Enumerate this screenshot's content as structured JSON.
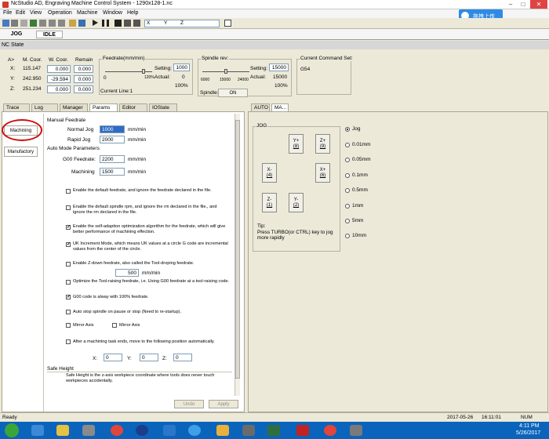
{
  "window": {
    "title": "NcStudio AD, Engraving Machine Control System - 1290x128-1.nc"
  },
  "menu": [
    "File",
    "Edit",
    "View",
    "Operation",
    "Machine",
    "Window",
    "Help"
  ],
  "toolbar": {
    "axis_x": "X",
    "axis_y": "Y",
    "axis_z": "Z"
  },
  "cloud_button": {
    "label": "拖拽上传"
  },
  "mode": {
    "jog": "JOG",
    "idle": "IDLE"
  },
  "nc_state": {
    "header": "NC State",
    "cols": {
      "machine": "M. Coor.",
      "work": "W. Coor.",
      "remain": "Remain"
    },
    "arrow": "A>",
    "axes": [
      {
        "label": "X:",
        "machine": "115.147",
        "work": "0.000",
        "remain": "0.000"
      },
      {
        "label": "Y:",
        "machine": "242.950",
        "work": "-29.594",
        "remain": "0.000"
      },
      {
        "label": "Z:",
        "machine": "251.234",
        "work": "0.000",
        "remain": "0.000"
      }
    ],
    "feedrate": {
      "title": "Feedrate(mm/min)",
      "min": "0",
      "max": "120%",
      "setting_label": "Setting:",
      "setting": "1000",
      "actual_label": "Actual:",
      "actual": "0",
      "percent": "100%",
      "current_line": "Current Line:1"
    },
    "spindle": {
      "title": "Spindle rev:",
      "ticks": [
        "6000",
        "15000",
        "24000"
      ],
      "setting_label": "Setting:",
      "setting": "15000",
      "actual_label": "Actual:",
      "actual": "15000",
      "percent": "100%",
      "spindle_label": "Spindle:",
      "state": "ON"
    },
    "current_command": {
      "title": "Current Command Set:",
      "value": "G54"
    }
  },
  "left_tabs": [
    "Trace",
    "Log",
    "Manager",
    "Params",
    "Editor",
    "IOState"
  ],
  "side_buttons": {
    "machining": "Machining",
    "manufactory": "Manufactory"
  },
  "params": {
    "manual_feedrate": "Manual Feedrate",
    "normal_jog_label": "Normal Jog",
    "normal_jog": "1000",
    "rapid_jog_label": "Rapid Jog",
    "rapid_jog": "2000",
    "unit": "mm/min",
    "auto_mode": "Auto Mode Parameters",
    "g00_label": "G00 Feedrate:",
    "g00": "2200",
    "machining_label": "Machining",
    "machining": "1500",
    "checkboxes": [
      {
        "text": "Enable the default feedrate, and ignore the feedrate declared in the file.",
        "checked": false
      },
      {
        "text": "Enable the default spindle rpm, and ignore the rm declared in the file., and ignore the rm declared in the file.",
        "checked": false
      },
      {
        "text": "Enable the self-adaption optimization algorithm for the feedrate, which will give better performance of machining effection.",
        "checked": true
      },
      {
        "text": "UK Increment Mode, which means UK values at a circle G code are incremental values from the center of the circle.",
        "checked": true
      },
      {
        "text": "Enable Z-down feedrate, also called the Tool-droping feedrate.",
        "checked": false
      },
      {
        "text": "Optimize the Tool-raising feedrate, i.e. Using G00 feedrate at a tool-raising code.",
        "checked": false
      },
      {
        "text": "G00 code is alway with 100% feedrate.",
        "checked": true
      },
      {
        "text": "Auto stop spindle on pause or stop (Need to re-startup).",
        "checked": false
      },
      {
        "text": "Mirror Axis",
        "checked": false
      },
      {
        "text": "Mirror Axis",
        "checked": false
      },
      {
        "text": "After a machining task ends, move to the following position automatically.",
        "checked": false
      }
    ],
    "zdown_value": "500",
    "pos": {
      "x_label": "X:",
      "x": "0",
      "y_label": "Y:",
      "y": "0",
      "z_label": "Z:",
      "z": "0"
    },
    "safe_height": "Safe Height",
    "safe_height_desc": "Safe Height is the z-axis workpiece coordinate where tools does never touch workpieces accidentally.",
    "undo": "Undo",
    "apply": "Apply"
  },
  "right_tabs": [
    "AUTO",
    "MA..."
  ],
  "jog": {
    "title": "JOG",
    "buttons": [
      {
        "label": "Y+",
        "key": "(8)"
      },
      {
        "label": "Z+",
        "key": "(9)"
      },
      {
        "label": "X-",
        "key": "(4)"
      },
      {
        "label": "X+",
        "key": "(6)"
      },
      {
        "label": "Z-",
        "key": "(1)"
      },
      {
        "label": "Y-",
        "key": "(2)"
      }
    ],
    "tip_title": "Tip:",
    "tip": "Press TURBO(or CTRL) key to jog more rapidly",
    "steps": [
      "Jog",
      "0.01mm",
      "0.05mm",
      "0.1mm",
      "0.5mm",
      "1mm",
      "5mm",
      "10mm"
    ],
    "selected_step": 0
  },
  "status": {
    "ready": "Ready",
    "date": "2017-05-26",
    "time": "16:11:01",
    "num": "NUM"
  },
  "taskbar": {
    "time": "4:11 PM",
    "date": "5/26/2017"
  },
  "colors": {
    "taskbar": "#0a64bb",
    "cloud": "#2f8ae5",
    "annotation": "#cc1111"
  }
}
